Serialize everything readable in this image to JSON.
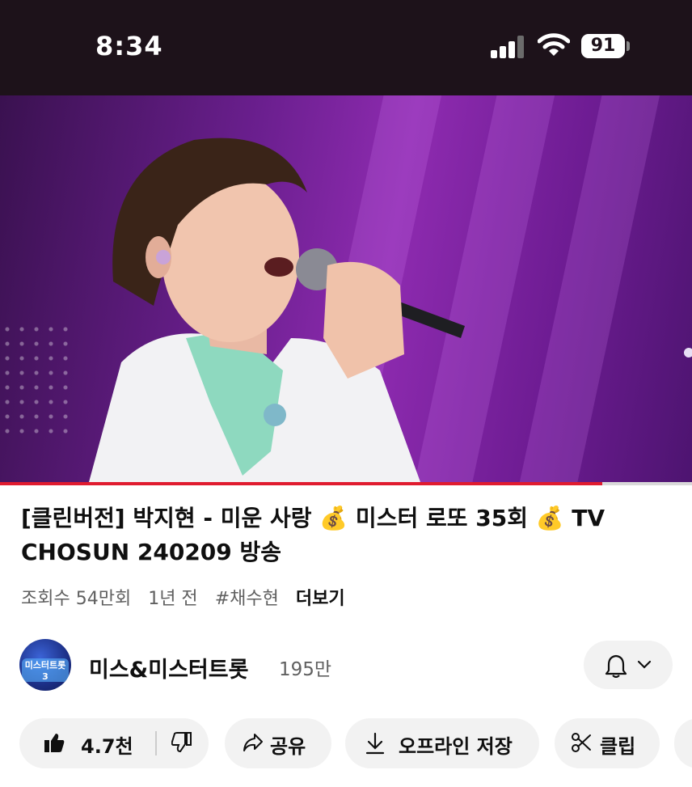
{
  "status_bar": {
    "time": "8:34",
    "battery": "91"
  },
  "video": {
    "progress_fraction": 0.87
  },
  "title": "[클린버전] 박지현 - 미운 사랑 💰 미스터 로또 35회 💰 TV CHOSUN 240209 방송",
  "meta": {
    "views": "조회수 54만회",
    "age": "1년 전",
    "hashtag": "#채수현",
    "more": "더보기"
  },
  "channel": {
    "avatar_text": "미스터트롯3",
    "name": "미스&미스터트롯",
    "subscribers": "195만"
  },
  "actions": {
    "like_count": "4.7천",
    "share": "공유",
    "download": "오프라인 저장",
    "clip": "클립"
  },
  "colors": {
    "accent": "#e01b2f",
    "status_bar_bg": "#1d121a",
    "pill_bg": "#f2f2f2"
  }
}
